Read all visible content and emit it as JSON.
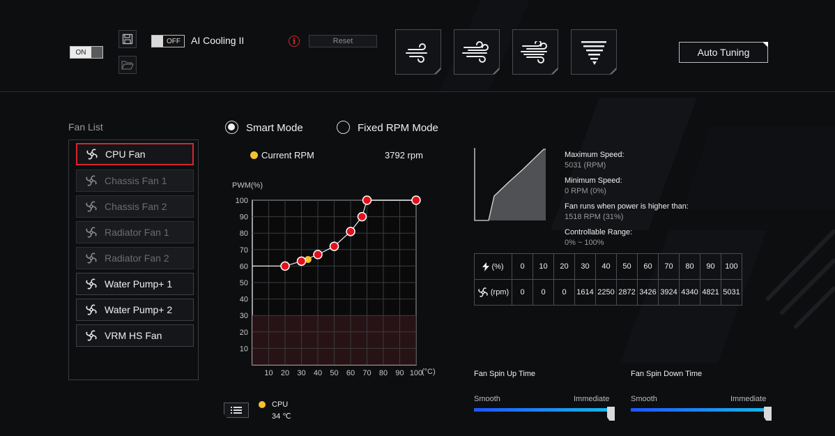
{
  "top": {
    "power_toggle": "ON",
    "ai_toggle": "OFF",
    "ai_label": "AI Cooling II",
    "reset_label": "Reset",
    "auto_tuning_label": "Auto Tuning",
    "presets": [
      {
        "name": "silent-preset",
        "icon": "wind-light-icon"
      },
      {
        "name": "standard-preset",
        "icon": "wind-medium-icon"
      },
      {
        "name": "turbo-preset",
        "icon": "wind-strong-icon"
      },
      {
        "name": "full-speed-preset",
        "icon": "tornado-icon"
      }
    ]
  },
  "fan_list": {
    "title": "Fan List",
    "items": [
      {
        "label": "CPU Fan",
        "state": "selected"
      },
      {
        "label": "Chassis Fan 1",
        "state": "disabled"
      },
      {
        "label": "Chassis Fan 2",
        "state": "disabled"
      },
      {
        "label": "Radiator Fan 1",
        "state": "disabled"
      },
      {
        "label": "Radiator Fan 2",
        "state": "disabled"
      },
      {
        "label": "Water Pump+ 1",
        "state": "enabled"
      },
      {
        "label": "Water Pump+ 2",
        "state": "enabled"
      },
      {
        "label": "VRM HS Fan",
        "state": "enabled"
      }
    ]
  },
  "modes": {
    "smart": "Smart Mode",
    "fixed": "Fixed RPM Mode",
    "selected": "smart"
  },
  "current_rpm": {
    "label": "Current RPM",
    "value": "3792 rpm"
  },
  "chart_data": {
    "type": "line",
    "ylabel": "PWM(%)",
    "xlabel": "(°C)",
    "x_ticks": [
      "10",
      "20",
      "30",
      "40",
      "50",
      "60",
      "70",
      "80",
      "90",
      "100"
    ],
    "y_ticks": [
      "10",
      "20",
      "30",
      "40",
      "50",
      "60",
      "70",
      "80",
      "90",
      "100"
    ],
    "xlim": [
      0,
      100
    ],
    "ylim": [
      0,
      100
    ],
    "grid": true,
    "danger_zone_max": 30,
    "curve_start_pwm": 60,
    "points": [
      {
        "x": 20,
        "y": 60
      },
      {
        "x": 30,
        "y": 63
      },
      {
        "x": 40,
        "y": 67
      },
      {
        "x": 50,
        "y": 72
      },
      {
        "x": 60,
        "y": 81
      },
      {
        "x": 67,
        "y": 90
      },
      {
        "x": 70,
        "y": 100
      },
      {
        "x": 100,
        "y": 100
      }
    ],
    "current": {
      "x": 34,
      "y": 64
    }
  },
  "speed_info": {
    "max_label": "Maximum Speed:",
    "max_value": "5031 (RPM)",
    "min_label": "Minimum Speed:",
    "min_value": "0 RPM (0%)",
    "threshold_label": "Fan runs when power is higher than:",
    "threshold_value": "1518 RPM (31%)",
    "range_label": "Controllable Range:",
    "range_value": "0% ~ 100%"
  },
  "rpm_table": {
    "percent_label": "(%)",
    "rpm_label": "(rpm)",
    "percent": [
      "0",
      "10",
      "20",
      "30",
      "40",
      "50",
      "60",
      "70",
      "80",
      "90",
      "100"
    ],
    "rpm": [
      "0",
      "0",
      "0",
      "1614",
      "2250",
      "2872",
      "3426",
      "3924",
      "4340",
      "4821",
      "5031"
    ]
  },
  "spin_up": {
    "title": "Fan Spin Up Time",
    "left": "Smooth",
    "right": "Immediate",
    "level": 1.0
  },
  "spin_down": {
    "title": "Fan Spin Down Time",
    "left": "Smooth",
    "right": "Immediate",
    "level": 1.0
  },
  "cpu_sensor": {
    "label": "CPU",
    "temp": "34 ℃"
  },
  "colors": {
    "accent": "#d8262e",
    "current_dot": "#f2c230",
    "slider_start": "#1f55ff",
    "slider_end": "#18b8e8"
  }
}
